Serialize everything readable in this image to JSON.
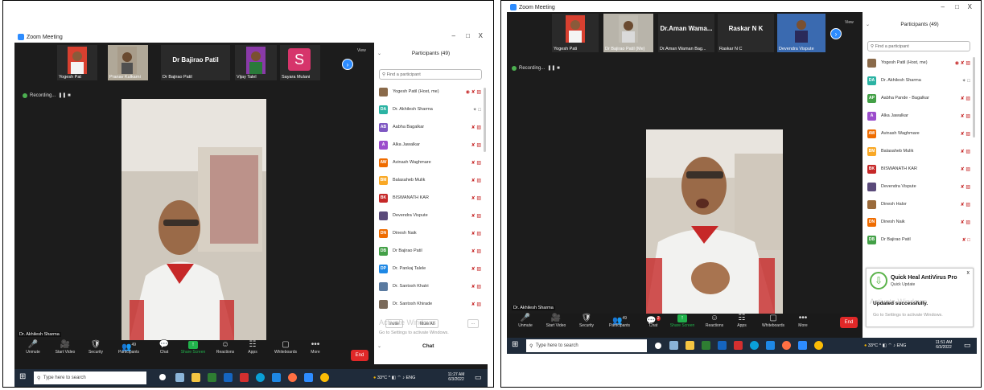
{
  "left": {
    "title": "Zoom Meeting",
    "window_controls": [
      "–",
      "□",
      "X"
    ],
    "thumbnails": [
      {
        "name": "Yogesh Pat"
      },
      {
        "name": "Pranav Kulkarni"
      },
      {
        "name": "Dr Bajirao Patil",
        "big_name": "Dr Bajirao Patil"
      },
      {
        "name": "Vijay Talel"
      },
      {
        "name": "Sayara Mulani",
        "avatar_letter": "S"
      }
    ],
    "view_label": "View",
    "recording_label": "Recording...",
    "active_speaker": "Dr. Akhilesh Sharma",
    "toolbar": [
      {
        "icon": "mic-icon",
        "glyph": "🎤",
        "label": "Unmute"
      },
      {
        "icon": "video-icon",
        "glyph": "🎥",
        "label": "Start Video"
      },
      {
        "icon": "shield-icon",
        "glyph": "🛡",
        "label": "Security"
      },
      {
        "icon": "participants-icon",
        "glyph": "👥",
        "label": "Participants",
        "count": "49"
      },
      {
        "icon": "chat-icon",
        "glyph": "💬",
        "label": "Chat"
      },
      {
        "icon": "share-screen-icon",
        "glyph": "↑",
        "label": "Share Screen"
      },
      {
        "icon": "reactions-icon",
        "glyph": "☺",
        "label": "Reactions"
      },
      {
        "icon": "apps-icon",
        "glyph": "☷",
        "label": "Apps"
      },
      {
        "icon": "whiteboards-icon",
        "glyph": "▢",
        "label": "Whiteboards"
      },
      {
        "icon": "more-icon",
        "glyph": "•••",
        "label": "More"
      }
    ],
    "end_label": "End",
    "panel": {
      "title": "Participants (49)",
      "search_placeholder": "Find a participant",
      "participants": [
        {
          "initials": "",
          "name": "Yogesh Patil (Host, me)",
          "color": "#8a6a4a",
          "photo": true,
          "icons": "◉ ✘ ▨"
        },
        {
          "initials": "DA",
          "name": "Dr. Akhilesh Sharma",
          "color": "#2bb3a3",
          "icons": "✦ □"
        },
        {
          "initials": "AB",
          "name": "Aabha Bagalkar",
          "color": "#7e57c2",
          "icons": "✘ ▨"
        },
        {
          "initials": "A",
          "name": "Alka Jawalkar",
          "color": "#9c4dcc",
          "icons": "✘ ▨"
        },
        {
          "initials": "AW",
          "name": "Avinash Waghmare",
          "color": "#ef6c00",
          "icons": "✘ ▨"
        },
        {
          "initials": "BM",
          "name": "Balasaheb Mulik",
          "color": "#f9a825",
          "icons": "✘ ▨"
        },
        {
          "initials": "BK",
          "name": "BISWANATH KAR",
          "color": "#c62828",
          "icons": "✘ ▨"
        },
        {
          "initials": "",
          "name": "Devendra Vispute",
          "color": "#5a4a7a",
          "photo": true,
          "icons": "✘ ▨"
        },
        {
          "initials": "DN",
          "name": "Dinesh Naik",
          "color": "#ef6c00",
          "icons": "✘ ▨"
        },
        {
          "initials": "DB",
          "name": "Dr Bajirao Patil",
          "color": "#43a047",
          "icons": "✘ ▨"
        },
        {
          "initials": "DP",
          "name": "Dr. Pankaj Talele",
          "color": "#1e88e5",
          "icons": "✘ ▨"
        },
        {
          "initials": "",
          "name": "Dr. Santosh Khatri",
          "color": "#5a7aa0",
          "photo": true,
          "icons": "✘ ▨"
        },
        {
          "initials": "",
          "name": "Dr. Santosh Khirade",
          "color": "#7a6a5a",
          "photo": true,
          "icons": "✘ ▨"
        }
      ],
      "invite_label": "Invite",
      "mute_all_label": "Mute All",
      "more_label": "...",
      "watermark_title": "Activate Windows",
      "watermark_sub": "Go to Settings to activate Windows.",
      "chat_label": "Chat"
    },
    "taskbar": {
      "search_placeholder": "Type here to search",
      "weather": "33°C",
      "lang": "ENG",
      "time": "11:27 AM",
      "date": "6/3/2022"
    }
  },
  "right": {
    "title": "Zoom Meeting",
    "window_controls": [
      "–",
      "□",
      "X"
    ],
    "thumbnails": [
      {
        "name": "Yogesh Pati"
      },
      {
        "name": "Dr Bajirao Patil (Me)"
      },
      {
        "name": "Dr.Aman Waman Bag...",
        "big_name": "Dr.Aman Wama..."
      },
      {
        "name": "Raskar N C",
        "big_name": "Raskar N K"
      },
      {
        "name": "Devendra Vispute"
      }
    ],
    "view_label": "View",
    "recording_label": "Recording...",
    "active_speaker": "Dr. Akhilesh Sharma",
    "toolbar": [
      {
        "icon": "mic-icon",
        "glyph": "🎤",
        "label": "Unmute"
      },
      {
        "icon": "video-icon",
        "glyph": "🎥",
        "label": "Start Video"
      },
      {
        "icon": "shield-icon",
        "glyph": "🛡",
        "label": "Security"
      },
      {
        "icon": "participants-icon",
        "glyph": "👥",
        "label": "Participants",
        "count": "49"
      },
      {
        "icon": "chat-icon",
        "glyph": "💬",
        "label": "Chat",
        "count": "2"
      },
      {
        "icon": "share-screen-icon",
        "glyph": "↑",
        "label": "Share Screen"
      },
      {
        "icon": "reactions-icon",
        "glyph": "☺",
        "label": "Reactions"
      },
      {
        "icon": "apps-icon",
        "glyph": "☷",
        "label": "Apps"
      },
      {
        "icon": "whiteboards-icon",
        "glyph": "▢",
        "label": "Whiteboards"
      },
      {
        "icon": "more-icon",
        "glyph": "•••",
        "label": "More"
      }
    ],
    "end_label": "End",
    "panel": {
      "title": "Participants (49)",
      "search_placeholder": "Find a participant",
      "participants": [
        {
          "initials": "",
          "name": "Yogesh Patil (Host, me)",
          "color": "#8a6a4a",
          "photo": true,
          "icons": "◉ ✘ ▨"
        },
        {
          "initials": "DA",
          "name": "Dr. Akhilesh Sharma",
          "color": "#2bb3a3",
          "icons": "✦ □"
        },
        {
          "initials": "AP",
          "name": "Aabha Pande - Bagalkar",
          "color": "#43a047",
          "icons": "✘ ▨"
        },
        {
          "initials": "A",
          "name": "Alka Jawalkar",
          "color": "#9c4dcc",
          "icons": "✘ ▨"
        },
        {
          "initials": "AW",
          "name": "Avinash Waghmare",
          "color": "#ef6c00",
          "icons": "✘ ▨"
        },
        {
          "initials": "BM",
          "name": "Balasaheb Mulik",
          "color": "#f9a825",
          "icons": "✘ ▨"
        },
        {
          "initials": "BK",
          "name": "BISWANATH KAR",
          "color": "#c62828",
          "icons": "✘ ▨"
        },
        {
          "initials": "",
          "name": "Devendra Vispute",
          "color": "#5a4a7a",
          "photo": true,
          "icons": "✘ ▨"
        },
        {
          "initials": "",
          "name": "Dinesh Halor",
          "color": "#9a6a3a",
          "photo": true,
          "icons": "✘ ▨"
        },
        {
          "initials": "DN",
          "name": "Dinesh Naik",
          "color": "#ef6c00",
          "icons": "✘ ▨"
        },
        {
          "initials": "DB",
          "name": "Dr Bajirao Patil",
          "color": "#43a047",
          "icons": "✘ □"
        }
      ],
      "watermark_title": "Activate Windows",
      "watermark_sub": "Go to Settings to activate Windows.",
      "toast_title": "Quick Heal AntiVirus Pro",
      "toast_sub": "Quick Update",
      "toast_msg": "Updated successfully."
    },
    "taskbar": {
      "search_placeholder": "Type here to search",
      "weather": "33°C",
      "lang": "ENG",
      "time": "11:51 AM",
      "date": "6/3/2022"
    }
  }
}
